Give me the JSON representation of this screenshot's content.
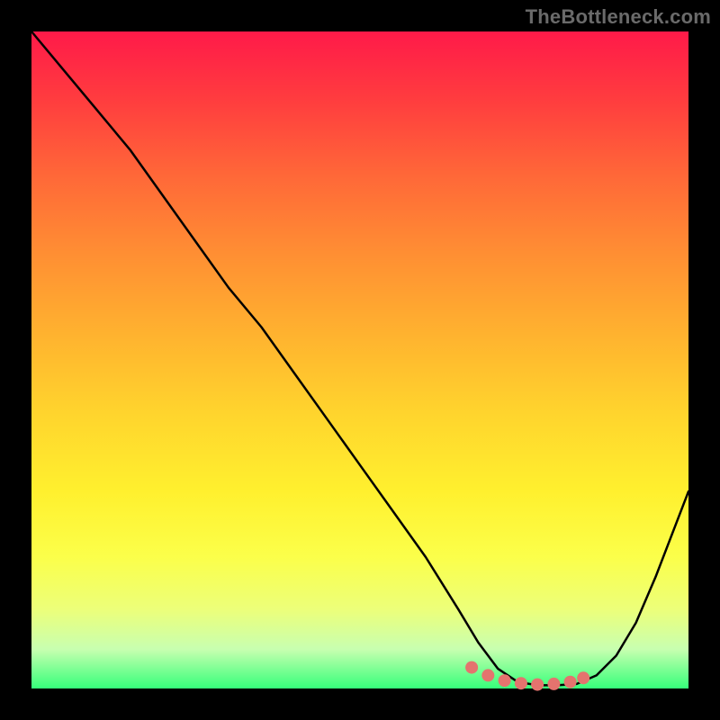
{
  "watermark": "TheBottleneck.com",
  "chart_data": {
    "type": "line",
    "title": "",
    "xlabel": "",
    "ylabel": "",
    "xlim": [
      0,
      100
    ],
    "ylim": [
      0,
      100
    ],
    "series": [
      {
        "name": "bottleneck-curve",
        "x": [
          0,
          5,
          10,
          15,
          20,
          25,
          30,
          35,
          40,
          45,
          50,
          55,
          60,
          65,
          68,
          71,
          74,
          77,
          80,
          83,
          86,
          89,
          92,
          95,
          100
        ],
        "values": [
          100,
          94,
          88,
          82,
          75,
          68,
          61,
          55,
          48,
          41,
          34,
          27,
          20,
          12,
          7,
          3,
          1,
          0.5,
          0.5,
          0.7,
          2,
          5,
          10,
          17,
          30
        ]
      }
    ],
    "highlight_points": {
      "name": "sweet-spot-dots",
      "x": [
        67,
        69.5,
        72,
        74.5,
        77,
        79.5,
        82,
        84
      ],
      "values": [
        3.2,
        2.0,
        1.2,
        0.8,
        0.6,
        0.7,
        1.0,
        1.6
      ]
    },
    "background_gradient": {
      "top_color": "#ff1a49",
      "bottom_color": "#36ff7a"
    }
  }
}
